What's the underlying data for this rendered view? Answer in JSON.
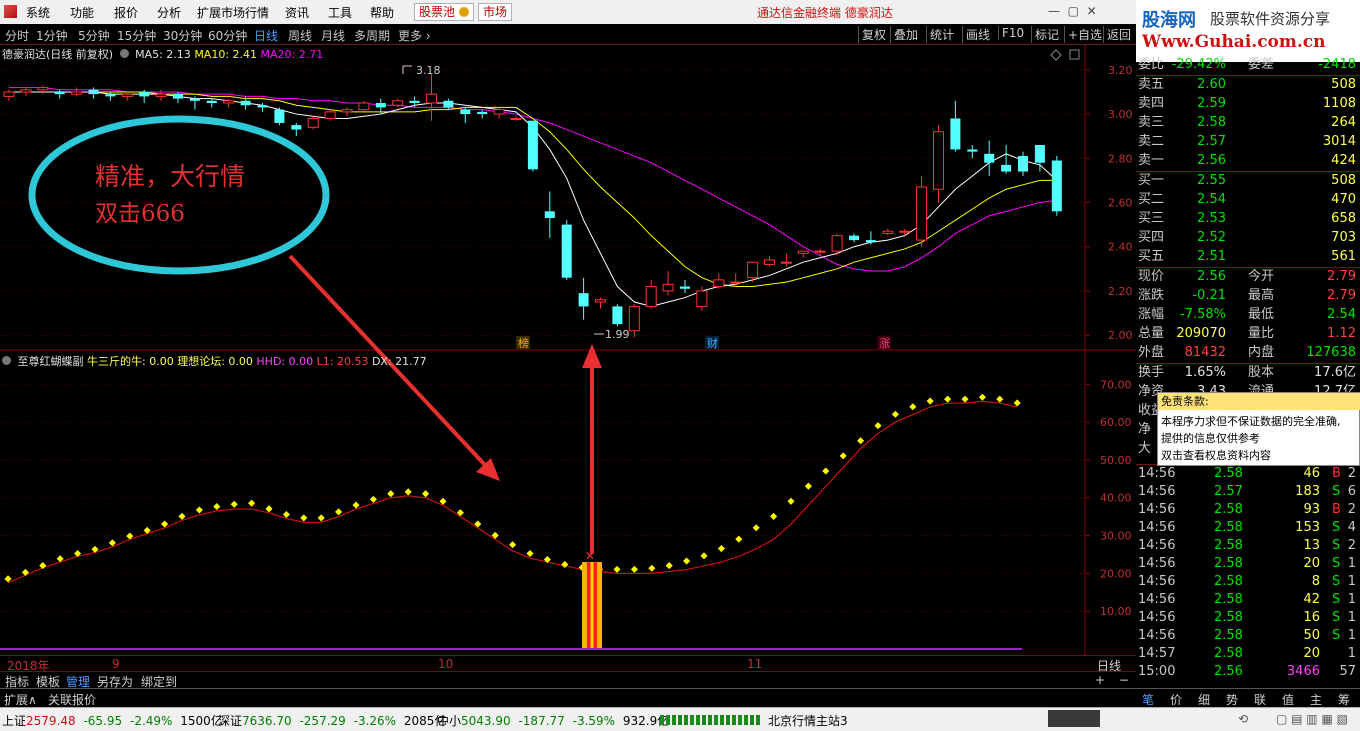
{
  "menu": {
    "items": [
      "系统",
      "功能",
      "报价",
      "分析",
      "扩展市场行情",
      "资讯",
      "工具",
      "帮助"
    ],
    "stock_pool": "股票池",
    "market": "市场",
    "center_title": "通达信金融终端  德豪润达"
  },
  "brand": {
    "site_cn": "股海网",
    "slogan": "股票软件资源分享",
    "url": "Www.Guhai.com.cn"
  },
  "periods": [
    "分时",
    "1分钟",
    "5分钟",
    "15分钟",
    "30分钟",
    "60分钟",
    "日线",
    "周线",
    "月线",
    "多周期",
    "更多"
  ],
  "active_period": "日线",
  "toolbar_right": [
    "复权",
    "叠加",
    "统计",
    "画线",
    "F10",
    "标记",
    "+自选",
    "返回"
  ],
  "main_header": {
    "name": "德豪润达(日线 前复权)",
    "ma5": "MA5: 2.13",
    "ma10": "MA10: 2.41",
    "ma20": "MA20: 2.71"
  },
  "price_axis": [
    "3.20",
    "3.00",
    "2.80",
    "2.60",
    "2.40",
    "2.20",
    "2.00"
  ],
  "annotations": {
    "high": "3.18",
    "low": "1.99",
    "badges": [
      "榜",
      "财",
      "涨"
    ]
  },
  "callout": {
    "line1": "精准，大行情",
    "line2": "双击666"
  },
  "indicator_header": {
    "name": "至尊红蝴蝶副",
    "f1": "牛三斤的牛: 0.00",
    "f2": "理想论坛: 0.00",
    "f3": "HHD: 0.00",
    "f4": "L1: 20.53",
    "f5": "DX: 21.77"
  },
  "indicator_axis": [
    "70.00",
    "60.00",
    "50.00",
    "40.00",
    "30.00",
    "20.00",
    "10.00"
  ],
  "chart_data": {
    "type": "candlestick",
    "price_range": [
      1.96,
      3.24
    ],
    "candles": [
      [
        3.08,
        3.1,
        3.06,
        3.11
      ],
      [
        3.1,
        3.11,
        3.08,
        3.12
      ],
      [
        3.11,
        3.12,
        3.09,
        3.13
      ],
      [
        3.1,
        3.09,
        3.07,
        3.11
      ],
      [
        3.09,
        3.1,
        3.08,
        3.12
      ],
      [
        3.11,
        3.09,
        3.07,
        3.12
      ],
      [
        3.09,
        3.08,
        3.06,
        3.1
      ],
      [
        3.08,
        3.09,
        3.06,
        3.1
      ],
      [
        3.1,
        3.08,
        3.05,
        3.11
      ],
      [
        3.08,
        3.09,
        3.06,
        3.11
      ],
      [
        3.09,
        3.07,
        3.05,
        3.1
      ],
      [
        3.07,
        3.06,
        3.02,
        3.08
      ],
      [
        3.06,
        3.05,
        3.03,
        3.07
      ],
      [
        3.05,
        3.06,
        3.03,
        3.07
      ],
      [
        3.06,
        3.04,
        3.02,
        3.08
      ],
      [
        3.04,
        3.03,
        3.01,
        3.05
      ],
      [
        3.02,
        2.96,
        2.95,
        3.03
      ],
      [
        2.95,
        2.93,
        2.9,
        2.96
      ],
      [
        2.94,
        2.98,
        2.93,
        2.99
      ],
      [
        2.98,
        3.01,
        2.97,
        3.02
      ],
      [
        3.01,
        3.02,
        2.99,
        3.03
      ],
      [
        3.02,
        3.05,
        3.01,
        3.06
      ],
      [
        3.05,
        3.03,
        3.0,
        3.07
      ],
      [
        3.04,
        3.06,
        3.03,
        3.07
      ],
      [
        3.06,
        3.05,
        3.03,
        3.08
      ],
      [
        3.05,
        3.09,
        2.97,
        3.18
      ],
      [
        3.06,
        3.03,
        3.02,
        3.07
      ],
      [
        3.02,
        3.0,
        2.96,
        3.03
      ],
      [
        3.01,
        3.0,
        2.98,
        3.02
      ],
      [
        3.0,
        3.02,
        2.98,
        3.03
      ],
      [
        2.98,
        2.98,
        2.97,
        2.99
      ],
      [
        2.97,
        2.75,
        2.74,
        2.97
      ],
      [
        2.56,
        2.53,
        2.44,
        2.65
      ],
      [
        2.5,
        2.26,
        2.25,
        2.52
      ],
      [
        2.19,
        2.13,
        2.07,
        2.26
      ],
      [
        2.15,
        2.16,
        2.12,
        2.17
      ],
      [
        2.13,
        2.05,
        2.04,
        2.14
      ],
      [
        2.02,
        2.13,
        1.99,
        2.14
      ],
      [
        2.13,
        2.22,
        2.12,
        2.25
      ],
      [
        2.2,
        2.23,
        2.18,
        2.29
      ],
      [
        2.22,
        2.21,
        2.19,
        2.25
      ],
      [
        2.13,
        2.2,
        2.11,
        2.22
      ],
      [
        2.22,
        2.25,
        2.21,
        2.28
      ],
      [
        2.24,
        2.24,
        2.22,
        2.28
      ],
      [
        2.26,
        2.33,
        2.24,
        2.33
      ],
      [
        2.32,
        2.34,
        2.31,
        2.36
      ],
      [
        2.33,
        2.33,
        2.31,
        2.37
      ],
      [
        2.37,
        2.38,
        2.35,
        2.38
      ],
      [
        2.38,
        2.38,
        2.36,
        2.39
      ],
      [
        2.38,
        2.45,
        2.36,
        2.46
      ],
      [
        2.45,
        2.43,
        2.42,
        2.46
      ],
      [
        2.43,
        2.42,
        2.41,
        2.47
      ],
      [
        2.46,
        2.47,
        2.45,
        2.48
      ],
      [
        2.47,
        2.47,
        2.45,
        2.48
      ],
      [
        2.43,
        2.67,
        2.4,
        2.72
      ],
      [
        2.66,
        2.92,
        2.6,
        2.95
      ],
      [
        2.98,
        2.84,
        2.83,
        3.06
      ],
      [
        2.84,
        2.83,
        2.8,
        2.86
      ],
      [
        2.82,
        2.78,
        2.72,
        2.88
      ],
      [
        2.77,
        2.74,
        2.73,
        2.86
      ],
      [
        2.81,
        2.74,
        2.72,
        2.83
      ],
      [
        2.86,
        2.78,
        2.74,
        2.86
      ],
      [
        2.79,
        2.56,
        2.54,
        2.81
      ]
    ],
    "ma5": [
      3.1,
      3.1,
      3.1,
      3.1,
      3.1,
      3.1,
      3.09,
      3.09,
      3.09,
      3.09,
      3.08,
      3.07,
      3.07,
      3.06,
      3.05,
      3.04,
      3.02,
      3.0,
      2.99,
      2.98,
      2.98,
      2.99,
      3.0,
      3.02,
      3.04,
      3.05,
      3.05,
      3.04,
      3.03,
      3.02,
      3.01,
      2.94,
      2.84,
      2.71,
      2.52,
      2.37,
      2.22,
      2.15,
      2.13,
      2.15,
      2.17,
      2.2,
      2.22,
      2.23,
      2.25,
      2.27,
      2.3,
      2.33,
      2.35,
      2.37,
      2.4,
      2.42,
      2.43,
      2.45,
      2.5,
      2.58,
      2.66,
      2.72,
      2.78,
      2.82,
      2.79,
      2.77,
      2.7
    ],
    "ma10": [
      3.1,
      3.1,
      3.1,
      3.1,
      3.1,
      3.1,
      3.1,
      3.1,
      3.1,
      3.09,
      3.09,
      3.09,
      3.08,
      3.08,
      3.07,
      3.07,
      3.06,
      3.04,
      3.03,
      3.02,
      3.01,
      3.01,
      3.01,
      3.01,
      3.01,
      3.02,
      3.02,
      3.03,
      3.03,
      3.03,
      3.03,
      2.98,
      2.92,
      2.84,
      2.75,
      2.67,
      2.6,
      2.53,
      2.45,
      2.38,
      2.31,
      2.26,
      2.23,
      2.22,
      2.22,
      2.23,
      2.24,
      2.26,
      2.28,
      2.3,
      2.33,
      2.35,
      2.37,
      2.39,
      2.42,
      2.47,
      2.52,
      2.57,
      2.62,
      2.66,
      2.68,
      2.7,
      2.7
    ],
    "ma20": [
      3.12,
      3.12,
      3.12,
      3.11,
      3.11,
      3.11,
      3.11,
      3.1,
      3.1,
      3.1,
      3.1,
      3.09,
      3.09,
      3.09,
      3.08,
      3.08,
      3.07,
      3.07,
      3.06,
      3.06,
      3.05,
      3.05,
      3.04,
      3.04,
      3.03,
      3.03,
      3.03,
      3.02,
      3.02,
      3.01,
      3.0,
      2.98,
      2.96,
      2.93,
      2.9,
      2.87,
      2.84,
      2.81,
      2.78,
      2.74,
      2.7,
      2.66,
      2.62,
      2.58,
      2.54,
      2.5,
      2.45,
      2.4,
      2.36,
      2.32,
      2.3,
      2.29,
      2.29,
      2.31,
      2.35,
      2.4,
      2.46,
      2.5,
      2.54,
      2.56,
      2.58,
      2.6,
      2.61
    ],
    "indicator_range": [
      0,
      78
    ],
    "indicator_line": [
      17.5,
      19.5,
      21.5,
      23,
      24.5,
      25.5,
      27,
      29,
      30.5,
      32,
      34,
      35.5,
      36.5,
      37,
      37,
      36,
      34.5,
      33.5,
      33.5,
      35,
      37,
      38.5,
      40,
      40.5,
      40,
      38,
      35,
      32,
      29,
      26,
      24,
      23,
      22,
      21,
      20.5,
      20,
      20,
      20,
      20.5,
      21,
      22,
      23,
      24.5,
      26.5,
      29,
      33,
      38,
      43,
      48,
      53,
      57,
      60,
      62,
      64,
      65,
      65,
      65.5,
      65,
      64
    ],
    "indicator_dots": [
      17.5,
      19.2,
      21,
      22.8,
      24.2,
      25.3,
      27,
      28.8,
      30.3,
      32,
      34,
      35.7,
      36.6,
      37.2,
      37.5,
      36,
      34.5,
      33.6,
      33.6,
      35.2,
      37,
      38.5,
      40,
      40.5,
      40,
      38,
      35,
      32,
      29,
      26.5,
      24.2,
      22.6,
      21.3,
      20.5,
      20,
      20,
      20,
      20.3,
      21,
      22.2,
      23.6,
      25.5,
      28,
      31,
      34,
      38,
      42,
      46,
      50,
      54,
      58,
      61,
      63,
      64.5,
      65,
      65,
      65.5,
      65,
      64
    ],
    "signal_bar": {
      "x_index": 34,
      "value": 23
    }
  },
  "dates": {
    "year": "2018年",
    "m9": "9",
    "m10": "10",
    "m11": "11"
  },
  "period_label": "日线",
  "tabs": [
    "指标",
    "模板",
    "管理",
    "另存为",
    "绑定到"
  ],
  "active_tab": "管理",
  "ext_tabs": [
    "扩展∧",
    "关联报价"
  ],
  "right_tabs": [
    "笔",
    "价",
    "细",
    "势",
    "联",
    "值",
    "主",
    "筹"
  ],
  "quote": {
    "top": {
      "label": "委比",
      "value": "-29.42%",
      "label2": "委差",
      "value2": "-2418"
    },
    "asks": [
      {
        "label": "卖五",
        "price": "2.60",
        "vol": "508"
      },
      {
        "label": "卖四",
        "price": "2.59",
        "vol": "1108"
      },
      {
        "label": "卖三",
        "price": "2.58",
        "vol": "264"
      },
      {
        "label": "卖二",
        "price": "2.57",
        "vol": "3014"
      },
      {
        "label": "卖一",
        "price": "2.56",
        "vol": "424"
      }
    ],
    "bids": [
      {
        "label": "买一",
        "price": "2.55",
        "vol": "508"
      },
      {
        "label": "买二",
        "price": "2.54",
        "vol": "470"
      },
      {
        "label": "买三",
        "price": "2.53",
        "vol": "658"
      },
      {
        "label": "买四",
        "price": "2.52",
        "vol": "703"
      },
      {
        "label": "买五",
        "price": "2.51",
        "vol": "561"
      }
    ],
    "stats": [
      {
        "l1": "现价",
        "v1": "2.56",
        "l2": "今开",
        "v2": "2.79"
      },
      {
        "l1": "涨跌",
        "v1": "-0.21",
        "l2": "最高",
        "v2": "2.79"
      },
      {
        "l1": "涨幅",
        "v1": "-7.58%",
        "l2": "最低",
        "v2": "2.54"
      },
      {
        "l1": "总量",
        "v1": "209070",
        "l2": "量比",
        "v2": "1.12"
      },
      {
        "l1": "外盘",
        "v1": "81432",
        "l2": "内盘",
        "v2": "127638"
      }
    ],
    "stats2": [
      {
        "l1": "换手",
        "v1": "1.65%",
        "l2": "股本",
        "v2": "17.6亿"
      },
      {
        "l1": "净资",
        "v1": "3.43",
        "l2": "流通",
        "v2": "12.7亿"
      },
      {
        "l1": "收益"
      },
      {
        "l1": "净"
      },
      {
        "l1": "大"
      }
    ]
  },
  "disclaimer": {
    "title": "免责条款:",
    "lines": [
      "本程序力求但不保证数据的完全准确,",
      "提供的信息仅供参考",
      "双击查看权息资料内容"
    ]
  },
  "ticks": [
    {
      "t": "14:56",
      "p": "2.58",
      "v": "46",
      "bs": "B",
      "n": "2"
    },
    {
      "t": "14:56",
      "p": "2.57",
      "v": "183",
      "bs": "S",
      "n": "6"
    },
    {
      "t": "14:56",
      "p": "2.58",
      "v": "93",
      "bs": "B",
      "n": "2"
    },
    {
      "t": "14:56",
      "p": "2.58",
      "v": "153",
      "bs": "S",
      "n": "4"
    },
    {
      "t": "14:56",
      "p": "2.58",
      "v": "13",
      "bs": "S",
      "n": "2"
    },
    {
      "t": "14:56",
      "p": "2.58",
      "v": "20",
      "bs": "S",
      "n": "1"
    },
    {
      "t": "14:56",
      "p": "2.58",
      "v": "8",
      "bs": "S",
      "n": "1"
    },
    {
      "t": "14:56",
      "p": "2.58",
      "v": "42",
      "bs": "S",
      "n": "1"
    },
    {
      "t": "14:56",
      "p": "2.58",
      "v": "16",
      "bs": "S",
      "n": "1"
    },
    {
      "t": "14:56",
      "p": "2.58",
      "v": "50",
      "bs": "S",
      "n": "1"
    },
    {
      "t": "14:57",
      "p": "2.58",
      "v": "20",
      "bs": "",
      "n": "1"
    },
    {
      "t": "15:00",
      "p": "2.56",
      "v": "3466",
      "bs": "",
      "n": "57"
    }
  ],
  "status": {
    "sh": {
      "label": "上证",
      "v": "2579.48",
      "c": "-65.95",
      "p": "-2.49%",
      "amt": "1500亿"
    },
    "sz": {
      "label": "深证",
      "v": "7636.70",
      "c": "-257.29",
      "p": "-3.26%",
      "amt": "2085亿"
    },
    "zx": {
      "label": "中小",
      "v": "5043.90",
      "c": "-187.77",
      "p": "-3.59%",
      "amt": "932.9亿"
    },
    "server": "北京行情主站3"
  },
  "colors": {
    "up": "#ff3232",
    "down": "#54ffff",
    "ma5": "#ffffff",
    "ma10": "#ffff00",
    "ma20": "#ff00ff",
    "indicator_line": "#cc1010",
    "dots": "#ffff00",
    "callout_ring": "#2fc8d8",
    "arrow": "#e83030"
  }
}
